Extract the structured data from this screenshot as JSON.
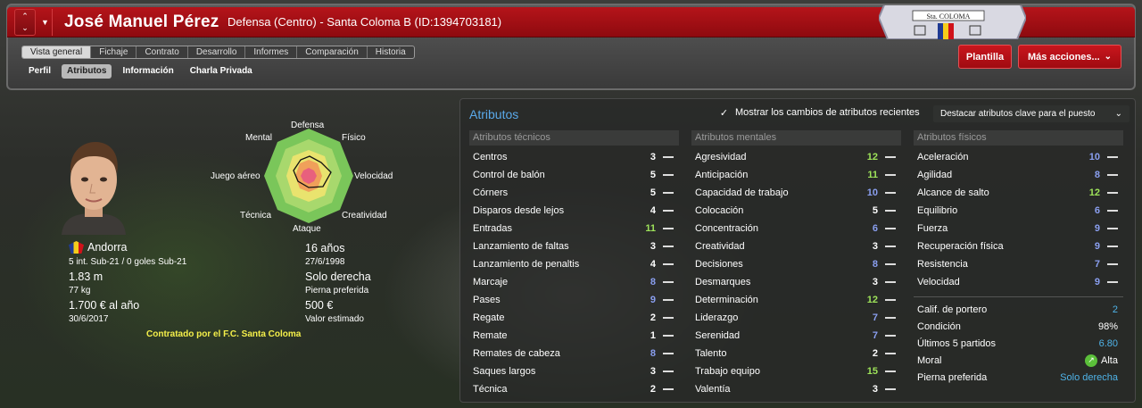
{
  "header": {
    "name": "José Manuel Pérez",
    "subtitle": "Defensa (Centro) - Santa Coloma B (ID:1394703181)",
    "badge_text": "Sta. COLOMA"
  },
  "tabs": [
    {
      "label": "Vista general",
      "active": true
    },
    {
      "label": "Fichaje"
    },
    {
      "label": "Contrato"
    },
    {
      "label": "Desarrollo"
    },
    {
      "label": "Informes"
    },
    {
      "label": "Comparación"
    },
    {
      "label": "Historia"
    }
  ],
  "subtabs": [
    {
      "label": "Perfil"
    },
    {
      "label": "Atributos",
      "active": true
    },
    {
      "label": "Información"
    },
    {
      "label": "Charla Privada"
    }
  ],
  "buttons": {
    "squad": "Plantilla",
    "more": "Más acciones...",
    "more_icon": "chevron-down-icon"
  },
  "radar": {
    "labels": {
      "top": "Defensa",
      "top_right": "Físico",
      "right": "Velocidad",
      "bottom_right": "Creatividad",
      "bottom": "Ataque",
      "bottom_left": "Técnica",
      "left": "Juego aéreo",
      "top_left": "Mental"
    }
  },
  "profile": {
    "nation": "Andorra",
    "caps": "5 int. Sub-21 / 0 goles Sub-21",
    "height": "1.83 m",
    "weight": "77 kg",
    "wage": "1.700 € al año",
    "contract_end": "30/6/2017",
    "age": "16 años",
    "dob": "27/6/1998",
    "foot": "Solo derecha",
    "foot_label": "Pierna preferida",
    "value": "500 €",
    "value_label": "Valor estimado",
    "contracted_by": "Contratado por el F.C. Santa Coloma"
  },
  "attributes": {
    "title": "Atributos",
    "show_changes_label": "Mostrar los cambios de atributos recientes",
    "show_changes_checked": true,
    "highlight_label": "Destacar atributos clave para el puesto",
    "technical": {
      "header": "Atributos técnicos",
      "rows": [
        {
          "name": "Centros",
          "value": "3",
          "color": "white"
        },
        {
          "name": "Control de balón",
          "value": "5",
          "color": "white"
        },
        {
          "name": "Córners",
          "value": "5",
          "color": "white"
        },
        {
          "name": "Disparos desde lejos",
          "value": "4",
          "color": "white"
        },
        {
          "name": "Entradas",
          "value": "11",
          "color": "green"
        },
        {
          "name": "Lanzamiento de faltas",
          "value": "3",
          "color": "white"
        },
        {
          "name": "Lanzamiento de penaltis",
          "value": "4",
          "color": "white"
        },
        {
          "name": "Marcaje",
          "value": "8",
          "color": "blue"
        },
        {
          "name": "Pases",
          "value": "9",
          "color": "blue"
        },
        {
          "name": "Regate",
          "value": "2",
          "color": "white"
        },
        {
          "name": "Remate",
          "value": "1",
          "color": "white"
        },
        {
          "name": "Remates de cabeza",
          "value": "8",
          "color": "blue"
        },
        {
          "name": "Saques largos",
          "value": "3",
          "color": "white"
        },
        {
          "name": "Técnica",
          "value": "2",
          "color": "white"
        }
      ]
    },
    "mental": {
      "header": "Atributos mentales",
      "rows": [
        {
          "name": "Agresividad",
          "value": "12",
          "color": "green"
        },
        {
          "name": "Anticipación",
          "value": "11",
          "color": "green"
        },
        {
          "name": "Capacidad de trabajo",
          "value": "10",
          "color": "blue"
        },
        {
          "name": "Colocación",
          "value": "5",
          "color": "white"
        },
        {
          "name": "Concentración",
          "value": "6",
          "color": "blue"
        },
        {
          "name": "Creatividad",
          "value": "3",
          "color": "white"
        },
        {
          "name": "Decisiones",
          "value": "8",
          "color": "blue"
        },
        {
          "name": "Desmarques",
          "value": "3",
          "color": "white"
        },
        {
          "name": "Determinación",
          "value": "12",
          "color": "green"
        },
        {
          "name": "Liderazgo",
          "value": "7",
          "color": "blue"
        },
        {
          "name": "Serenidad",
          "value": "7",
          "color": "blue"
        },
        {
          "name": "Talento",
          "value": "2",
          "color": "white"
        },
        {
          "name": "Trabajo equipo",
          "value": "15",
          "color": "green"
        },
        {
          "name": "Valentía",
          "value": "3",
          "color": "white"
        }
      ]
    },
    "physical": {
      "header": "Atributos físicos",
      "rows": [
        {
          "name": "Aceleración",
          "value": "10",
          "color": "blue"
        },
        {
          "name": "Agilidad",
          "value": "8",
          "color": "blue"
        },
        {
          "name": "Alcance de salto",
          "value": "12",
          "color": "green"
        },
        {
          "name": "Equilibrio",
          "value": "6",
          "color": "blue"
        },
        {
          "name": "Fuerza",
          "value": "9",
          "color": "blue"
        },
        {
          "name": "Recuperación física",
          "value": "9",
          "color": "blue"
        },
        {
          "name": "Resistencia",
          "value": "7",
          "color": "blue"
        },
        {
          "name": "Velocidad",
          "value": "9",
          "color": "blue"
        }
      ],
      "extra": [
        {
          "label": "Calif. de portero",
          "value": "2",
          "color": "#4fb3e8"
        },
        {
          "label": "Condición",
          "value": "98%",
          "color": "#ffffff"
        },
        {
          "label": "Últimos 5 partidos",
          "value": "6.80",
          "color": "#4fb3e8"
        },
        {
          "label": "Moral",
          "value": "Alta",
          "color": "#ffffff",
          "icon": "arrow-up-icon"
        },
        {
          "label": "Pierna preferida",
          "value": "Solo derecha",
          "color": "#4fb3e8"
        }
      ]
    }
  },
  "colors": {
    "accent_red": "#b5141a",
    "link_blue": "#5aa9ea",
    "value_green": "#9ee35a",
    "value_blue": "#8a9ff0"
  }
}
